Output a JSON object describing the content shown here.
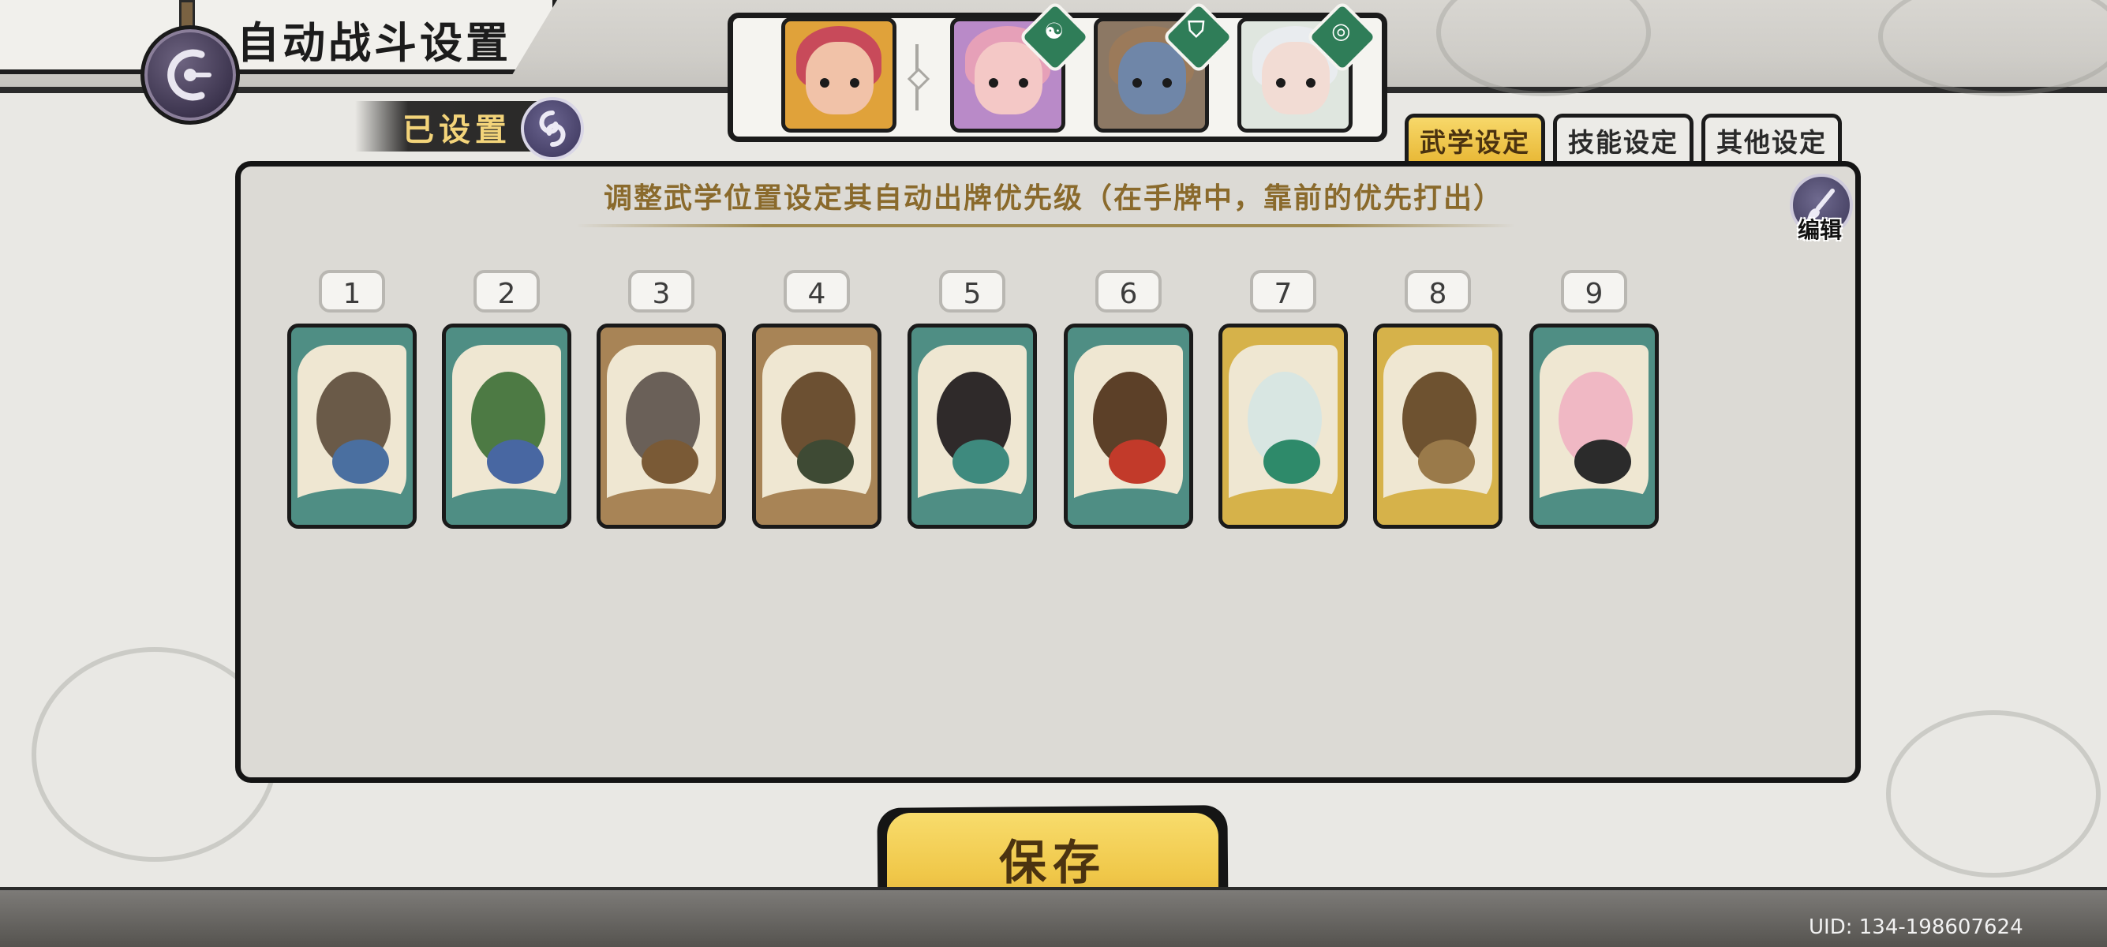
{
  "header": {
    "title": "自动战斗设置",
    "back_icon": "back-icon",
    "set_status": "已设置",
    "set_icon": "swirl-icon"
  },
  "team": {
    "members": [
      {
        "name": "leader",
        "bg": "#e0a23a",
        "skin": "#f1c2a8",
        "hair": "#c84a5a",
        "badge": ""
      },
      {
        "name": "member-2",
        "bg": "#b98ac8",
        "skin": "#f4c8c6",
        "hair": "#e6a0b8",
        "badge": "☯"
      },
      {
        "name": "member-3",
        "bg": "#8c7864",
        "skin": "#6f86a8",
        "hair": "#9b7a5a",
        "badge": "⛉"
      },
      {
        "name": "member-4",
        "bg": "#dfe6df",
        "skin": "#f2dcd4",
        "hair": "#e9ecef",
        "badge": "◎"
      }
    ]
  },
  "tabs": [
    {
      "label": "武学设定",
      "active": true
    },
    {
      "label": "技能设定",
      "active": false
    },
    {
      "label": "其他设定",
      "active": false
    }
  ],
  "panel": {
    "hint": "调整武学位置设定其自动出牌优先级（在手牌中，靠前的优先打出）",
    "edit_label": "编辑",
    "edit_icon": "brush-icon"
  },
  "cards": [
    {
      "slot": "1",
      "frame": "#4f8e84",
      "figure": "#6a5a48",
      "accent": "#4a6fa0"
    },
    {
      "slot": "2",
      "frame": "#4f8e84",
      "figure": "#4d7a44",
      "accent": "#4867a2"
    },
    {
      "slot": "3",
      "frame": "#a88456",
      "figure": "#6a6058",
      "accent": "#7a5a36"
    },
    {
      "slot": "4",
      "frame": "#a88456",
      "figure": "#6c5032",
      "accent": "#3e4a34"
    },
    {
      "slot": "5",
      "frame": "#4f8e84",
      "figure": "#2f2a2a",
      "accent": "#3e8a7e"
    },
    {
      "slot": "6",
      "frame": "#4f8e84",
      "figure": "#5c4028",
      "accent": "#c23a2a"
    },
    {
      "slot": "7",
      "frame": "#d6b24a",
      "figure": "#d8e6e2",
      "accent": "#2e8a6a"
    },
    {
      "slot": "8",
      "frame": "#d6b24a",
      "figure": "#6e5230",
      "accent": "#9a7a4a"
    },
    {
      "slot": "9",
      "frame": "#4f8e84",
      "figure": "#f0b8c4",
      "accent": "#2b2b2b"
    }
  ],
  "save_label": "保存",
  "uid": "UID: 134-198607624",
  "colors": {
    "accent": "#f0c84a",
    "panel": "#dcdad5",
    "hint": "#8a6a2c"
  }
}
